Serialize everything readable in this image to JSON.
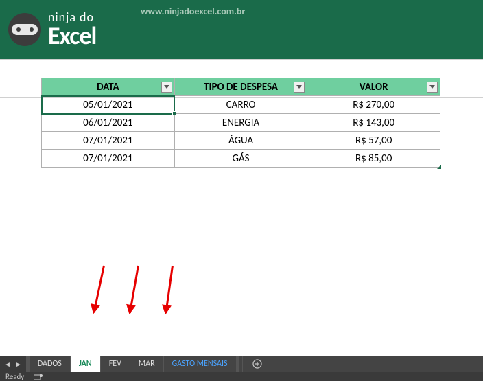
{
  "header": {
    "brand_top": "ninja do",
    "brand_bottom": "Excel",
    "url": "www.ninjadoexcel.com.br"
  },
  "table": {
    "headers": [
      "DATA",
      "TIPO DE DESPESA",
      "VALOR"
    ],
    "rows": [
      {
        "data": "05/01/2021",
        "tipo": "CARRO",
        "valor": "R$ 270,00"
      },
      {
        "data": "06/01/2021",
        "tipo": "ENERGIA",
        "valor": "R$ 143,00"
      },
      {
        "data": "07/01/2021",
        "tipo": "ÁGUA",
        "valor": "R$ 57,00"
      },
      {
        "data": "07/01/2021",
        "tipo": "GÁS",
        "valor": "R$ 85,00"
      }
    ]
  },
  "tabs": {
    "items": [
      "DADOS",
      "JAN",
      "FEV",
      "MAR",
      "GASTO MENSAIS"
    ],
    "active": "JAN",
    "accent": "GASTO MENSAIS"
  },
  "status": {
    "ready": "Ready"
  }
}
